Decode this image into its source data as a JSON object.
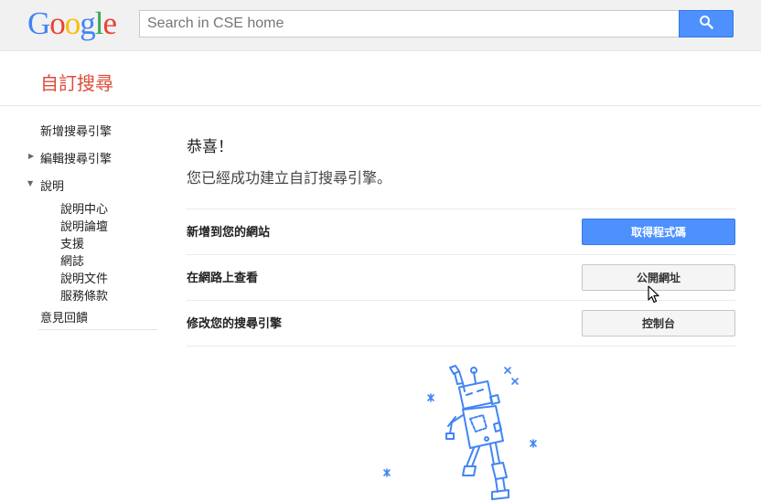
{
  "header": {
    "logo_letters": [
      {
        "ch": "G",
        "color": "#4285f4"
      },
      {
        "ch": "o",
        "color": "#ea4335"
      },
      {
        "ch": "o",
        "color": "#fbbc05"
      },
      {
        "ch": "g",
        "color": "#4285f4"
      },
      {
        "ch": "l",
        "color": "#34a853"
      },
      {
        "ch": "e",
        "color": "#ea4335"
      }
    ],
    "search_placeholder": "Search in CSE home"
  },
  "product": {
    "title": "自訂搜尋"
  },
  "sidebar": {
    "new_engine": "新增搜尋引擎",
    "edit_engine": "編輯搜尋引擎",
    "help": "說明",
    "help_items": [
      "說明中心",
      "說明論壇",
      "支援",
      "網誌",
      "說明文件",
      "服務條款"
    ],
    "feedback": "意見回饋"
  },
  "main": {
    "congrats": "恭喜！",
    "created_message": "您已經成功建立自訂搜尋引擎。",
    "rows": [
      {
        "label": "新增到您的網站",
        "button": "取得程式碼"
      },
      {
        "label": "在網路上查看",
        "button": "公開網址"
      },
      {
        "label": "修改您的搜尋引擎",
        "button": "控制台"
      }
    ]
  },
  "colors": {
    "accent_blue": "#4d90fe",
    "product_red": "#dd4b39",
    "robot_blue": "#4285f4"
  }
}
